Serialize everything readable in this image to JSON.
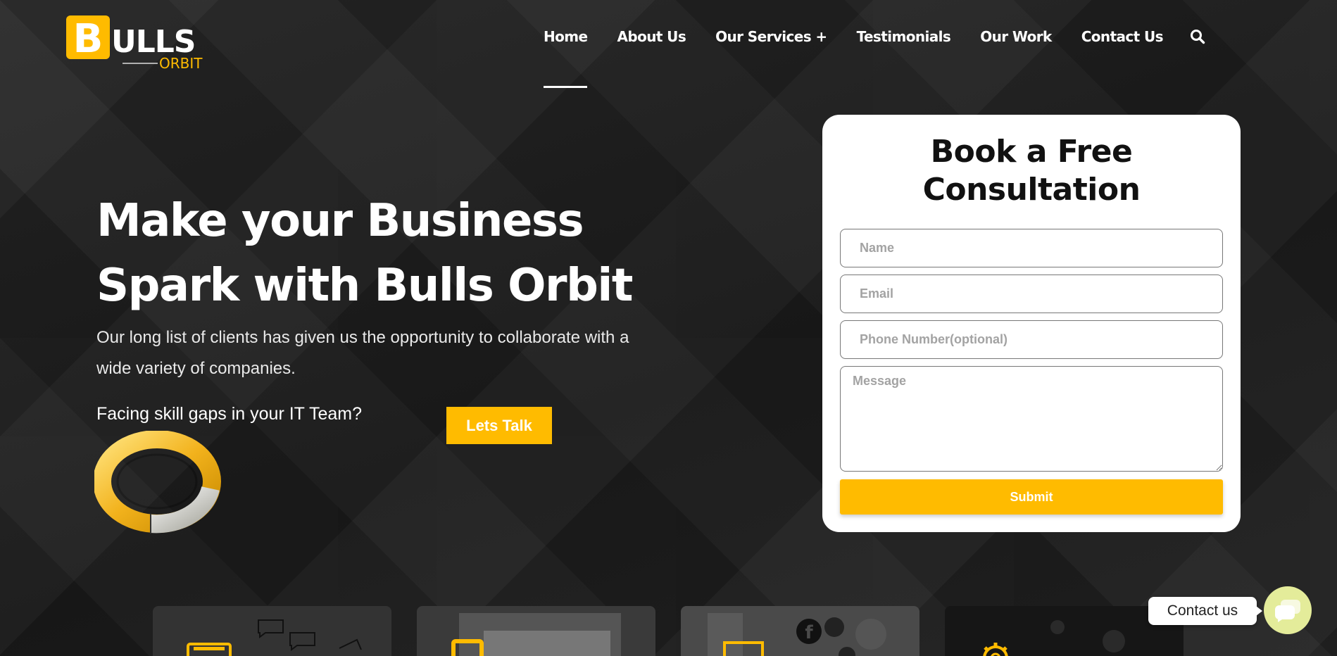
{
  "brand": {
    "logo_main": "ULLS",
    "logo_initial": "B",
    "logo_sub": "ORBIT",
    "accent": "#ffbb00"
  },
  "nav": {
    "items": [
      {
        "label": "Home",
        "active": true
      },
      {
        "label": "About Us"
      },
      {
        "label": "Our Services +"
      },
      {
        "label": "Testimonials"
      },
      {
        "label": "Our Work"
      },
      {
        "label": "Contact Us"
      }
    ],
    "search_icon": "search-icon"
  },
  "hero": {
    "title_line1": "Make your Business",
    "title_line2": "Spark with Bulls Orbit",
    "subtitle": "Our long list of clients has given us the opportunity to collaborate with a wide variety of companies.",
    "skill_gap": "Facing skill gaps in your IT Team?",
    "cta": "Lets Talk"
  },
  "form": {
    "title_line1": "Book a Free",
    "title_line2": "Consultation",
    "name_placeholder": "Name",
    "email_placeholder": "Email",
    "phone_placeholder": "Phone Number(optional)",
    "message_placeholder": "Message",
    "submit": "Submit"
  },
  "contact_widget": {
    "label": "Contact us",
    "icon": "chat-bubbles-icon"
  }
}
